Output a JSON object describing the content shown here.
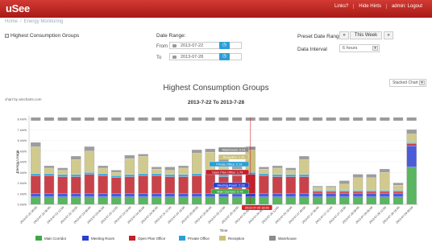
{
  "app": {
    "logo": "uSee",
    "nav": [
      "Links?",
      "Hide Hints",
      "admin: Logout"
    ]
  },
  "breadcrumb": [
    "Home",
    "Energy Monitoring"
  ],
  "filters": {
    "hcg_label": "Highest Consumption Groups",
    "hcg_checked": true,
    "date_range_title": "Date Range:",
    "from_label": "From",
    "from_value": "2013-07-22",
    "to_label": "To",
    "to_value": "2013-07-28",
    "preset_label": "Preset Date Ranges",
    "preset_prev": "«",
    "preset_current": "This Week",
    "preset_next": "»",
    "interval_label": "Data Interval",
    "interval_value": "6 hours"
  },
  "chart_controls": {
    "type_value": "Stacked Chart",
    "credit": "chart by amcharts.com"
  },
  "chart_data": {
    "type": "bar",
    "title": "Highest Consumption Groups",
    "subtitle": "2013-7-22 To 2013-7-28",
    "xlabel": "Time",
    "ylabel": "Energy Usage",
    "ylim": [
      0,
      8
    ],
    "y_ticks": [
      "0 kWh",
      "1 kWh",
      "2 kWh",
      "3 kWh",
      "4 kWh",
      "5 kWh",
      "6 kWh",
      "7 kWh",
      "8 kWh"
    ],
    "categories": [
      "2013-07-22 00:00",
      "2013-07-22 06:00",
      "2013-07-22 12:00",
      "2013-07-22 18:00",
      "2013-07-23 00:00",
      "2013-07-23 06:00",
      "2013-07-23 12:00",
      "2013-07-23 18:00",
      "2013-07-24 00:00",
      "2013-07-24 06:00",
      "2013-07-24 12:00",
      "2013-07-24 18:00",
      "2013-07-25 00:00",
      "2013-07-25 06:00",
      "2013-07-25 12:00",
      "2013-07-25 18:00",
      "2013-07-26 00:00",
      "2013-07-26 06:00",
      "2013-07-26 12:00",
      "2013-07-26 18:00",
      "2013-07-27 00:00",
      "2013-07-27 06:00",
      "2013-07-27 12:00",
      "2013-07-27 18:00",
      "2013-07-28 00:00",
      "2013-07-28 06:00",
      "2013-07-28 12:00",
      "2013-07-28 18:00",
      "2013-07-29 00:00"
    ],
    "series": [
      {
        "name": "Main Corridor",
        "color": "#3ea845",
        "values": [
          0.7,
          0.7,
          0.7,
          0.7,
          0.7,
          0.7,
          0.7,
          0.7,
          0.7,
          0.7,
          0.7,
          0.7,
          0.7,
          0.7,
          0.7,
          0.7,
          0.7,
          0.7,
          0.7,
          0.7,
          0.7,
          0.7,
          0.7,
          0.7,
          0.7,
          0.7,
          0.7,
          0.7,
          3.5
        ]
      },
      {
        "name": "Meeting Room",
        "color": "#2a3fd0",
        "values": [
          0.3,
          0.3,
          0.3,
          0.3,
          0.3,
          0.3,
          0.3,
          0.3,
          0.3,
          0.3,
          0.3,
          0.3,
          0.3,
          0.3,
          0.3,
          0.3,
          0.3,
          0.3,
          0.3,
          0.3,
          0.3,
          0.3,
          0.3,
          0.3,
          0.3,
          0.3,
          0.3,
          0.3,
          2.0
        ]
      },
      {
        "name": "Open Plan Office",
        "color": "#c0212a",
        "values": [
          1.7,
          1.7,
          1.6,
          1.6,
          1.8,
          1.7,
          1.5,
          1.6,
          1.7,
          1.7,
          1.6,
          1.6,
          1.7,
          1.8,
          1.6,
          1.7,
          1.8,
          1.7,
          1.6,
          1.6,
          1.6,
          0.2,
          0.2,
          0.2,
          0.2,
          0.2,
          0.2,
          0.2,
          0.2
        ]
      },
      {
        "name": "Private Office",
        "color": "#2a9fd6",
        "values": [
          0.2,
          0.2,
          0.2,
          0.2,
          0.2,
          0.2,
          0.2,
          0.2,
          0.2,
          0.2,
          0.2,
          0.2,
          0.2,
          0.2,
          0.2,
          0.2,
          0.2,
          0.2,
          0.2,
          0.2,
          0.2,
          0.1,
          0.1,
          0.1,
          0.1,
          0.1,
          0.1,
          0.1,
          0.1
        ]
      },
      {
        "name": "Reception",
        "color": "#c9c17a",
        "values": [
          2.5,
          0.5,
          0.4,
          1.4,
          2.0,
          0.5,
          0.3,
          1.5,
          1.6,
          0.4,
          0.4,
          0.6,
          1.9,
          1.9,
          1.2,
          0.4,
          2.1,
          0.4,
          0.6,
          0.4,
          1.4,
          0.3,
          0.3,
          0.6,
          1.2,
          1.2,
          1.7,
          0.5,
          0.8
        ]
      },
      {
        "name": "Warehouse",
        "color": "#8c8c8c",
        "values": [
          0.4,
          0.2,
          0.2,
          0.3,
          0.4,
          0.2,
          0.2,
          0.3,
          0.2,
          0.2,
          0.3,
          0.2,
          0.3,
          0.3,
          0.2,
          0.3,
          0.3,
          0.2,
          0.2,
          0.2,
          0.3,
          0.1,
          0.1,
          0.3,
          0.3,
          0.3,
          0.3,
          0.2,
          0.4
        ]
      }
    ],
    "highlight_index": 16,
    "tooltip_date": "2013-07-25 18:00",
    "tooltips": [
      {
        "series": "Warehouse",
        "text": "Warehouse: 0.23"
      },
      {
        "series": "Reception",
        "text": "Reception: 1.26"
      },
      {
        "series": "Private Office",
        "text": "Private Office: 0.19"
      },
      {
        "series": "Open Plan Office",
        "text": "Open Plan Office: 1.74"
      },
      {
        "series": "Meeting Room",
        "text": "Meeting Room: 0.28"
      },
      {
        "series": "Main Corridor",
        "text": "Main Corridor: 0.76"
      }
    ],
    "legend": [
      "Main Corridor",
      "Meeting Room",
      "Open Plan Office",
      "Private Office",
      "Reception",
      "Warehouse"
    ],
    "legend_placement": "bottom"
  }
}
